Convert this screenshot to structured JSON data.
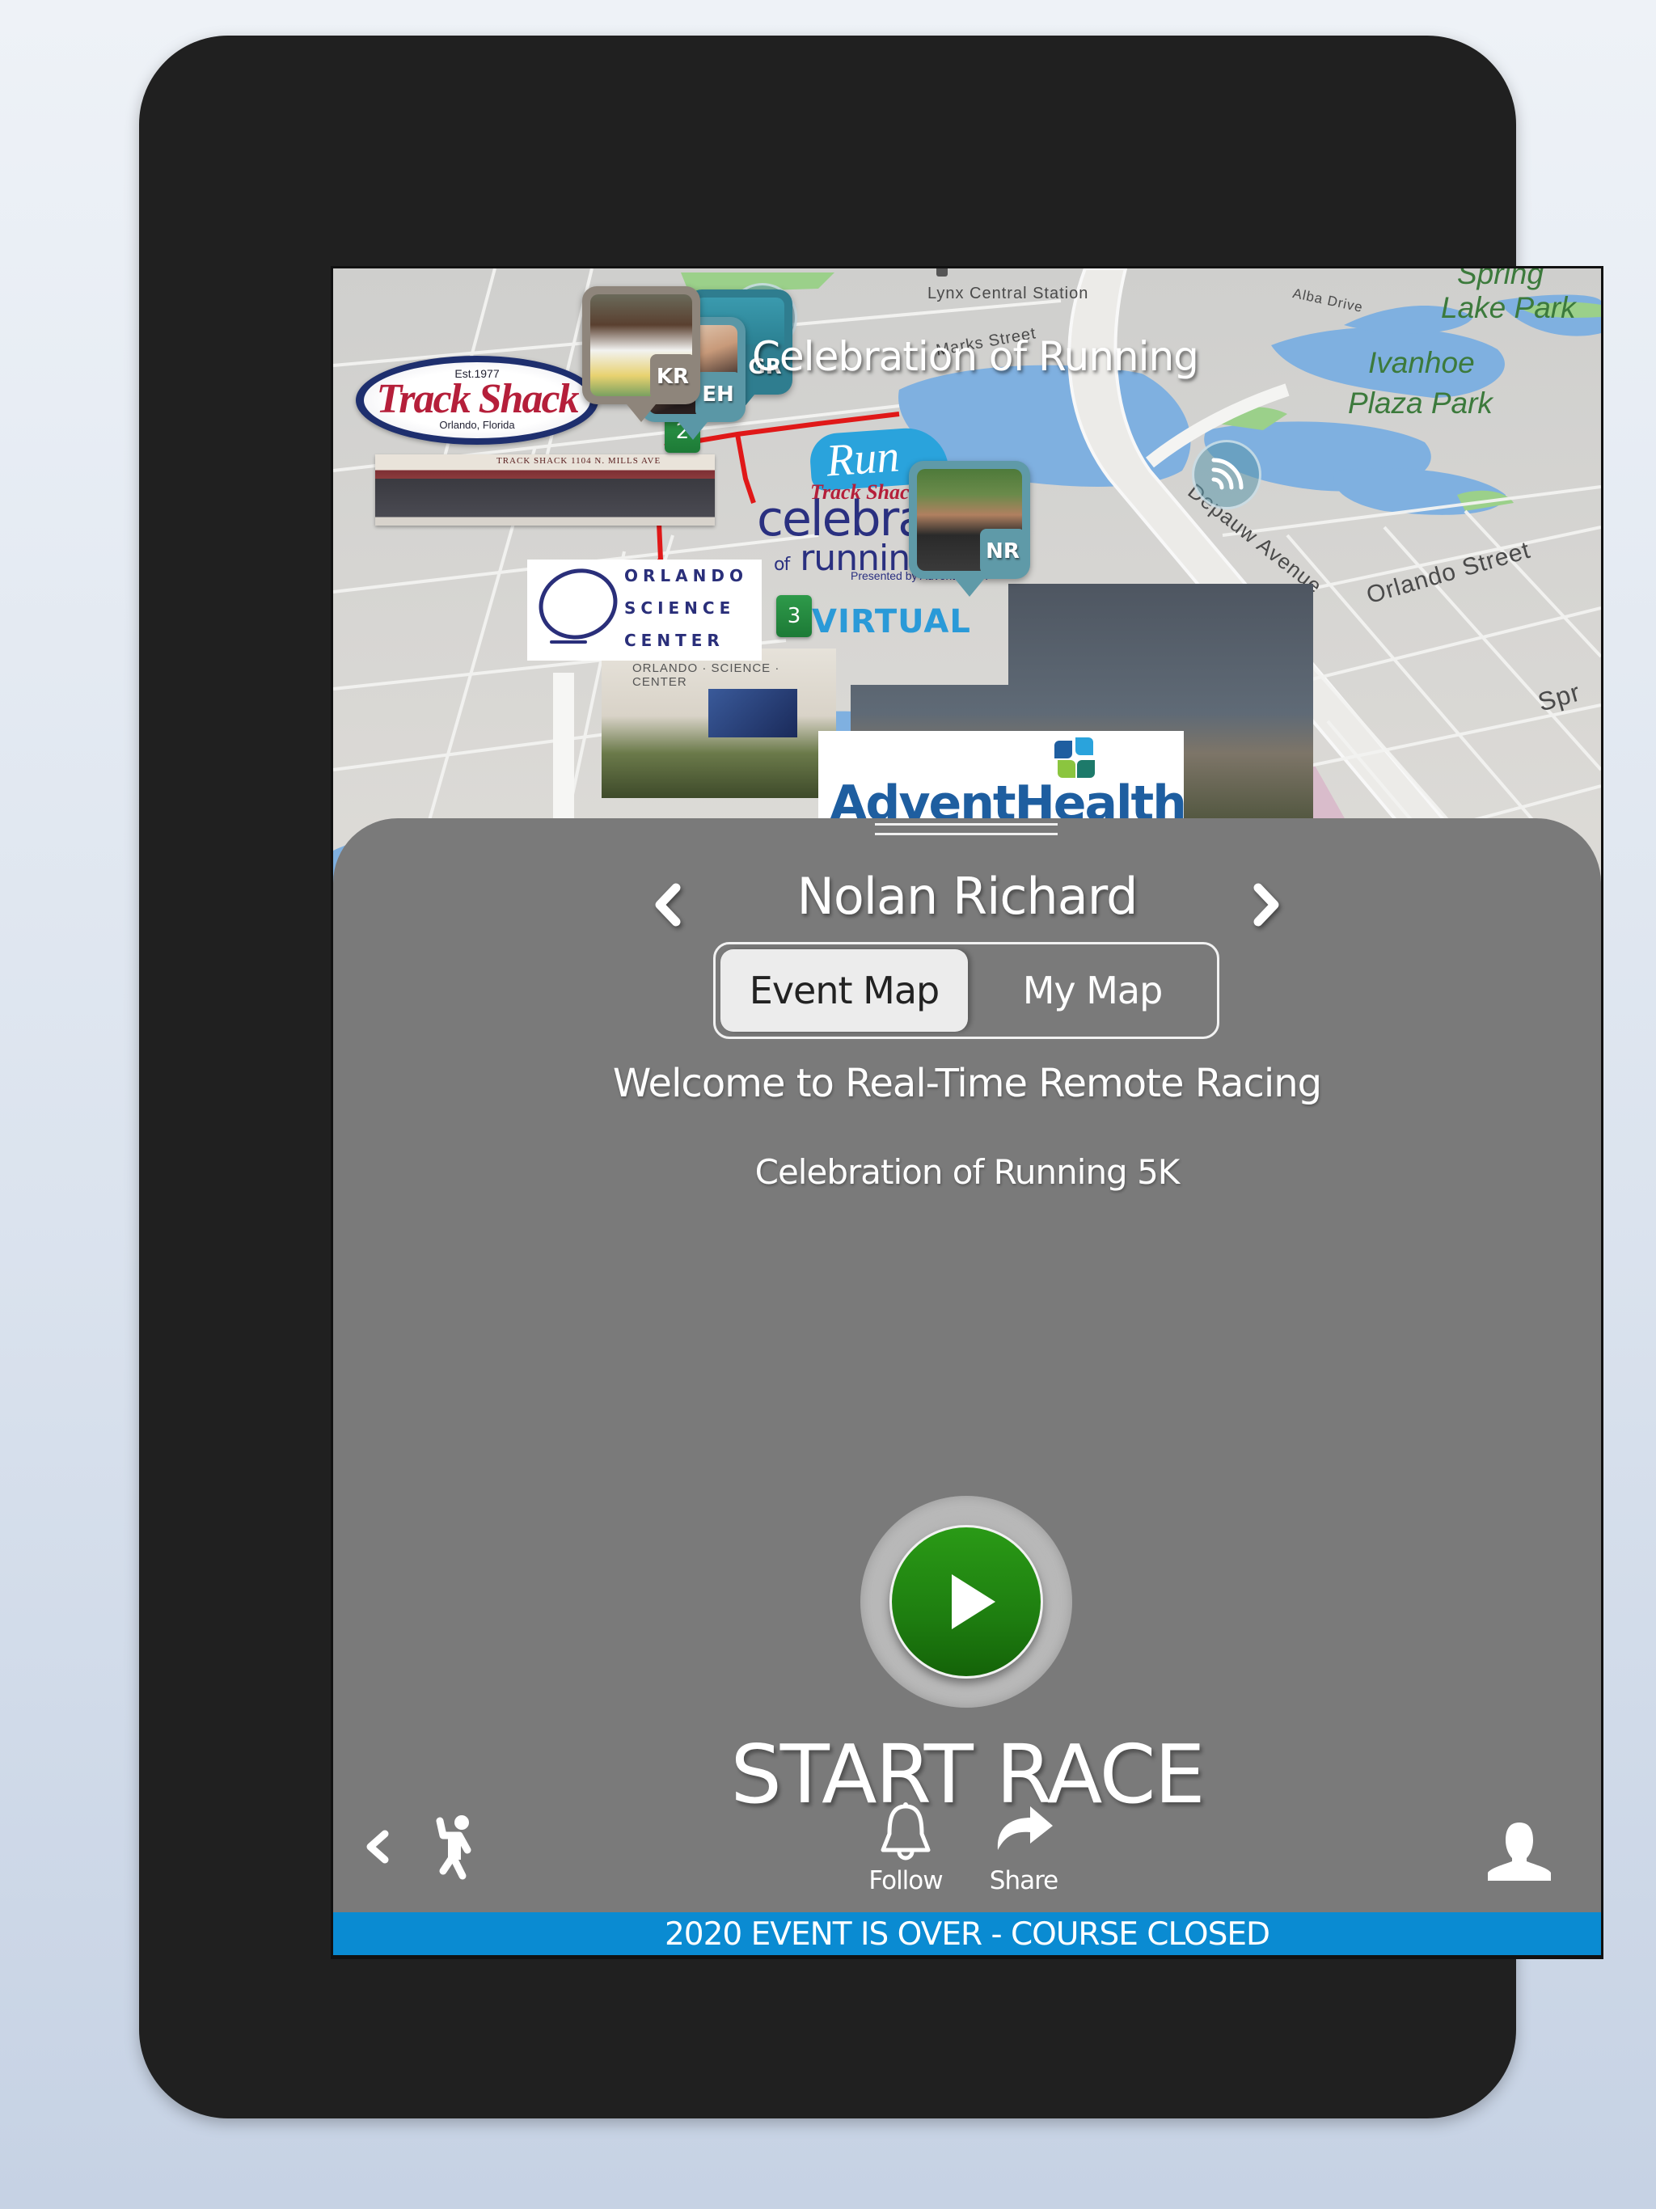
{
  "map": {
    "title": "Celebration of Running",
    "labels": {
      "lynx_station": "Lynx Central Station",
      "marks_street": "Marks Street",
      "alba_drive": "Alba Drive",
      "spring_lake_park_line1": "Spring",
      "spring_lake_park_line2": "Lake Park",
      "ivanhoe_line1": "Ivanhoe",
      "ivanhoe_line2": "Plaza Park",
      "depauw_avenue": "Depauw Avenue",
      "orlando_street": "Orlando Street",
      "spring_partial": "Spr"
    },
    "sponsors": {
      "trackshack_est": "Est.1977",
      "trackshack_name": "Track Shack",
      "trackshack_location": "Orlando, Florida",
      "storefront_sign": "TRACK SHACK   1104 N. MILLS AVE",
      "osc_line1": "ORLANDO",
      "osc_line2": "SCIENCE",
      "osc_line3": "CENTER",
      "osc_building_label": "ORLANDO · SCIENCE · CENTER",
      "advent_name": "AdventHealth",
      "run_logo": "Run",
      "run_trackshack": "Track Shack",
      "celebration_line1": "celebration",
      "celebration_of": "of",
      "celebration_line2": "running",
      "presented_by": "Presented by AdventHealth",
      "virtual": "VIRTUAL"
    },
    "course_markers": [
      "2",
      "3"
    ],
    "runners": [
      {
        "initials": "KR",
        "color": "#8e857b"
      },
      {
        "initials": "GR",
        "color": "#2f7d8f"
      },
      {
        "initials": "EH",
        "color": "#5a97a6"
      },
      {
        "initials": "NR",
        "color": "#5f9aa8"
      }
    ]
  },
  "panel": {
    "racer_name": "Nolan Richard",
    "tabs": [
      {
        "label": "Event Map",
        "active": true
      },
      {
        "label": "My Map",
        "active": false
      }
    ],
    "welcome": "Welcome to Real-Time Remote Racing",
    "event_name": "Celebration of Running 5K",
    "start_label": "START RACE",
    "start_button_color": "#1e7e10"
  },
  "bottom_bar": {
    "follow_label": "Follow",
    "share_label": "Share",
    "icons": [
      "chevron-left-icon",
      "runner-icon",
      "bell-icon",
      "share-arrow-icon",
      "user-icon"
    ]
  },
  "status_banner": {
    "text": "2020 EVENT IS OVER - COURSE CLOSED",
    "color": "#0a8bd2"
  }
}
